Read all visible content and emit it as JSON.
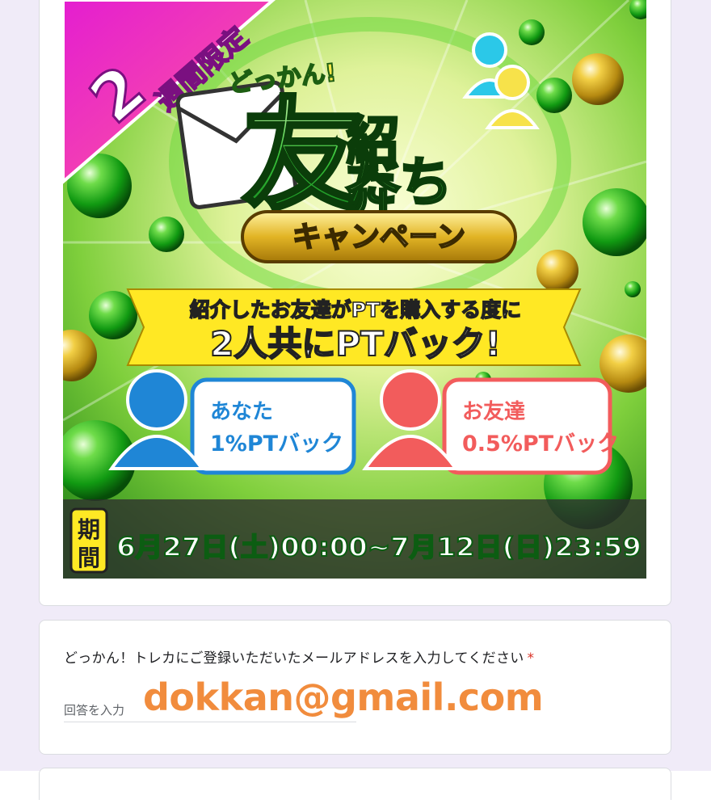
{
  "banner": {
    "corner_ribbon": {
      "number": "2",
      "text": "週間限定"
    },
    "tagline": "どっかん!",
    "title_tomo": "友",
    "title_dachi": "だち",
    "title_shokai": "紹介",
    "campaign_label": "キャンペーン",
    "ribbon_line1": "紹介したお友達がPTを購入する度に",
    "ribbon_line2": "2人共にPTバック!",
    "you_label": "あなた",
    "you_value": "1%PTバック",
    "friend_label": "お友達",
    "friend_value": "0.5%PTバック",
    "period_label_1": "期",
    "period_label_2": "間",
    "period_text": "6月27日(土)00:00~7月12日(日)23:59"
  },
  "question": {
    "label": "どっかん！トレカにご登録いただいたメールアドレスを入力してください",
    "required_mark": "*",
    "placeholder": "回答を入力",
    "handwritten_answer": "dokkan@gmail.com"
  }
}
